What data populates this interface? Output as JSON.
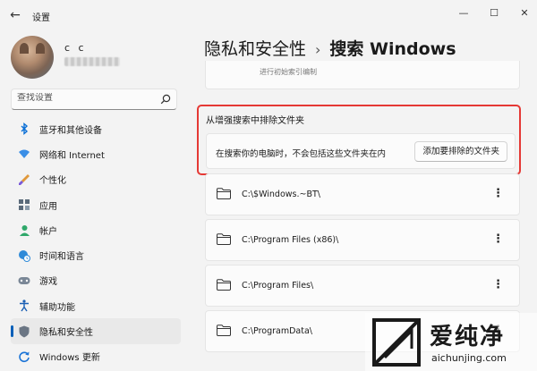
{
  "window": {
    "title": "设置",
    "back_icon": "arrow-left-icon",
    "controls": [
      "minimize-icon",
      "maximize-icon",
      "close-icon"
    ]
  },
  "account": {
    "name": "c c"
  },
  "search": {
    "placeholder": "查找设置"
  },
  "sidebar": {
    "items": [
      {
        "label": "蓝牙和其他设备",
        "icon": "bluetooth-icon",
        "active": false
      },
      {
        "label": "网络和 Internet",
        "icon": "wifi-icon",
        "active": false
      },
      {
        "label": "个性化",
        "icon": "brush-icon",
        "active": false
      },
      {
        "label": "应用",
        "icon": "apps-icon",
        "active": false
      },
      {
        "label": "帐户",
        "icon": "person-icon",
        "active": false
      },
      {
        "label": "时间和语言",
        "icon": "globe-clock-icon",
        "active": false
      },
      {
        "label": "游戏",
        "icon": "gamepad-icon",
        "active": false
      },
      {
        "label": "辅助功能",
        "icon": "accessibility-icon",
        "active": false
      },
      {
        "label": "隐私和安全性",
        "icon": "shield-icon",
        "active": true
      },
      {
        "label": "Windows 更新",
        "icon": "update-icon",
        "active": false
      }
    ]
  },
  "breadcrumb": {
    "parent": "隐私和安全性",
    "separator": "›",
    "current": "搜索 Windows"
  },
  "top_card": {
    "text": "进行初始索引编制"
  },
  "exclude": {
    "heading": "从增强搜索中排除文件夹",
    "description": "在搜索你的电脑时，不会包括这些文件夹在内",
    "add_button": "添加要排除的文件夹"
  },
  "folders": [
    {
      "path": "C:\\$Windows.~BT\\"
    },
    {
      "path": "C:\\Program Files (x86)\\"
    },
    {
      "path": "C:\\Program Files\\"
    },
    {
      "path": "C:\\ProgramData\\"
    }
  ],
  "watermark": {
    "brand": "爱纯净",
    "url": "aichunjing.com"
  },
  "colors": {
    "accent": "#005fb8",
    "highlight_border": "#e53935",
    "folder": "#e8b84a"
  }
}
